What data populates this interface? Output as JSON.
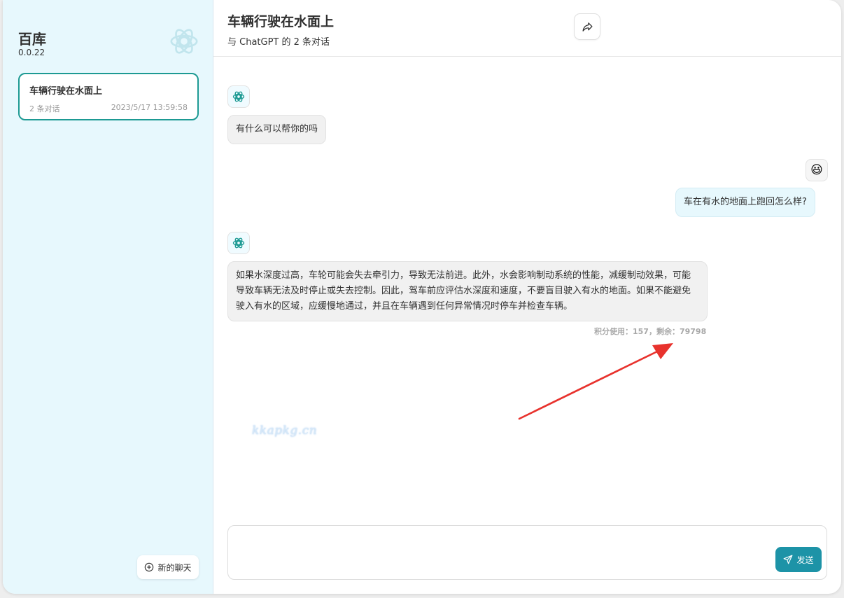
{
  "sidebar": {
    "app_title": "百库",
    "version": "0.0.22",
    "chats": [
      {
        "title": "车辆行驶在水面上",
        "count": "2 条对话",
        "time": "2023/5/17 13:59:58"
      }
    ],
    "new_chat_label": "新的聊天"
  },
  "header": {
    "title": "车辆行驶在水面上",
    "subtitle": "与 ChatGPT 的 2 条对话"
  },
  "messages": [
    {
      "role": "assistant",
      "text": "有什么可以帮你的吗"
    },
    {
      "role": "user",
      "text": "车在有水的地面上跑回怎么样?",
      "avatar_emoji": "😃"
    },
    {
      "role": "assistant",
      "text": "如果水深度过高，车轮可能会失去牵引力，导致无法前进。此外，水会影响制动系统的性能，减缓制动效果，可能导致车辆无法及时停止或失去控制。因此，驾车前应评估水深度和速度，不要盲目驶入有水的地面。如果不能避免驶入有水的区域，应缓慢地通过，并且在车辆遇到任何异常情况时停车并检查车辆。"
    }
  ],
  "usage_text": "积分使用：157，剩余：79798",
  "watermark_text": "kkapkg.cn",
  "input": {
    "placeholder": "",
    "send_label": "发送"
  },
  "colors": {
    "accent": "#1d9a93",
    "send_button": "#1d93a7",
    "sidebar_bg": "#e7f8fd",
    "arrow": "#e8322d"
  }
}
